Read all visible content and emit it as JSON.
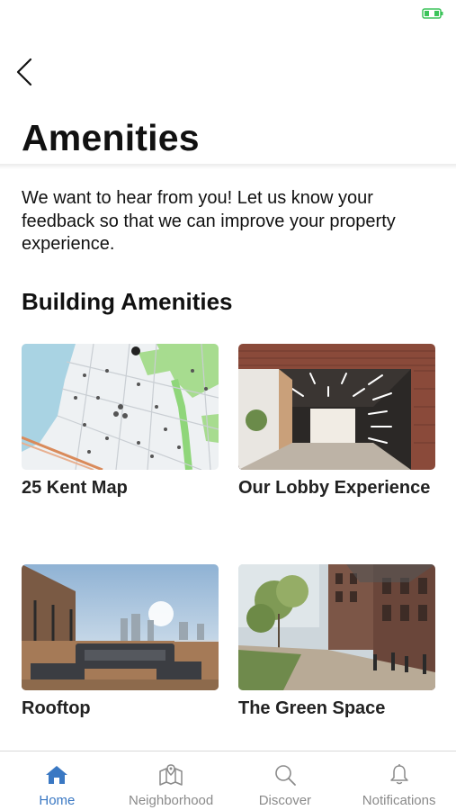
{
  "status_bar": {
    "battery_icon": "battery-charging-icon",
    "battery_color": "#3cc45a"
  },
  "header": {
    "back_icon": "chevron-left-icon",
    "title": "Amenities"
  },
  "intro": {
    "text": "We want to hear from you! Let us know your feedback so that we can improve your property experience."
  },
  "section": {
    "title": "Building Amenities"
  },
  "cards": [
    {
      "label": "25 Kent Map",
      "image": "neighborhood-map-image"
    },
    {
      "label": "Our Lobby Experience",
      "image": "lobby-photo"
    },
    {
      "label": "Rooftop",
      "image": "rooftop-photo"
    },
    {
      "label": "The Green Space",
      "image": "green-space-photo"
    }
  ],
  "tab_bar": {
    "active_color": "#3a78c3",
    "inactive_color": "#8a8a8a",
    "tabs": [
      {
        "label": "Home",
        "icon": "home-icon",
        "active": true
      },
      {
        "label": "Neighborhood",
        "icon": "map-icon",
        "active": false
      },
      {
        "label": "Discover",
        "icon": "search-icon",
        "active": false
      },
      {
        "label": "Notifications",
        "icon": "bell-icon",
        "active": false
      }
    ]
  }
}
